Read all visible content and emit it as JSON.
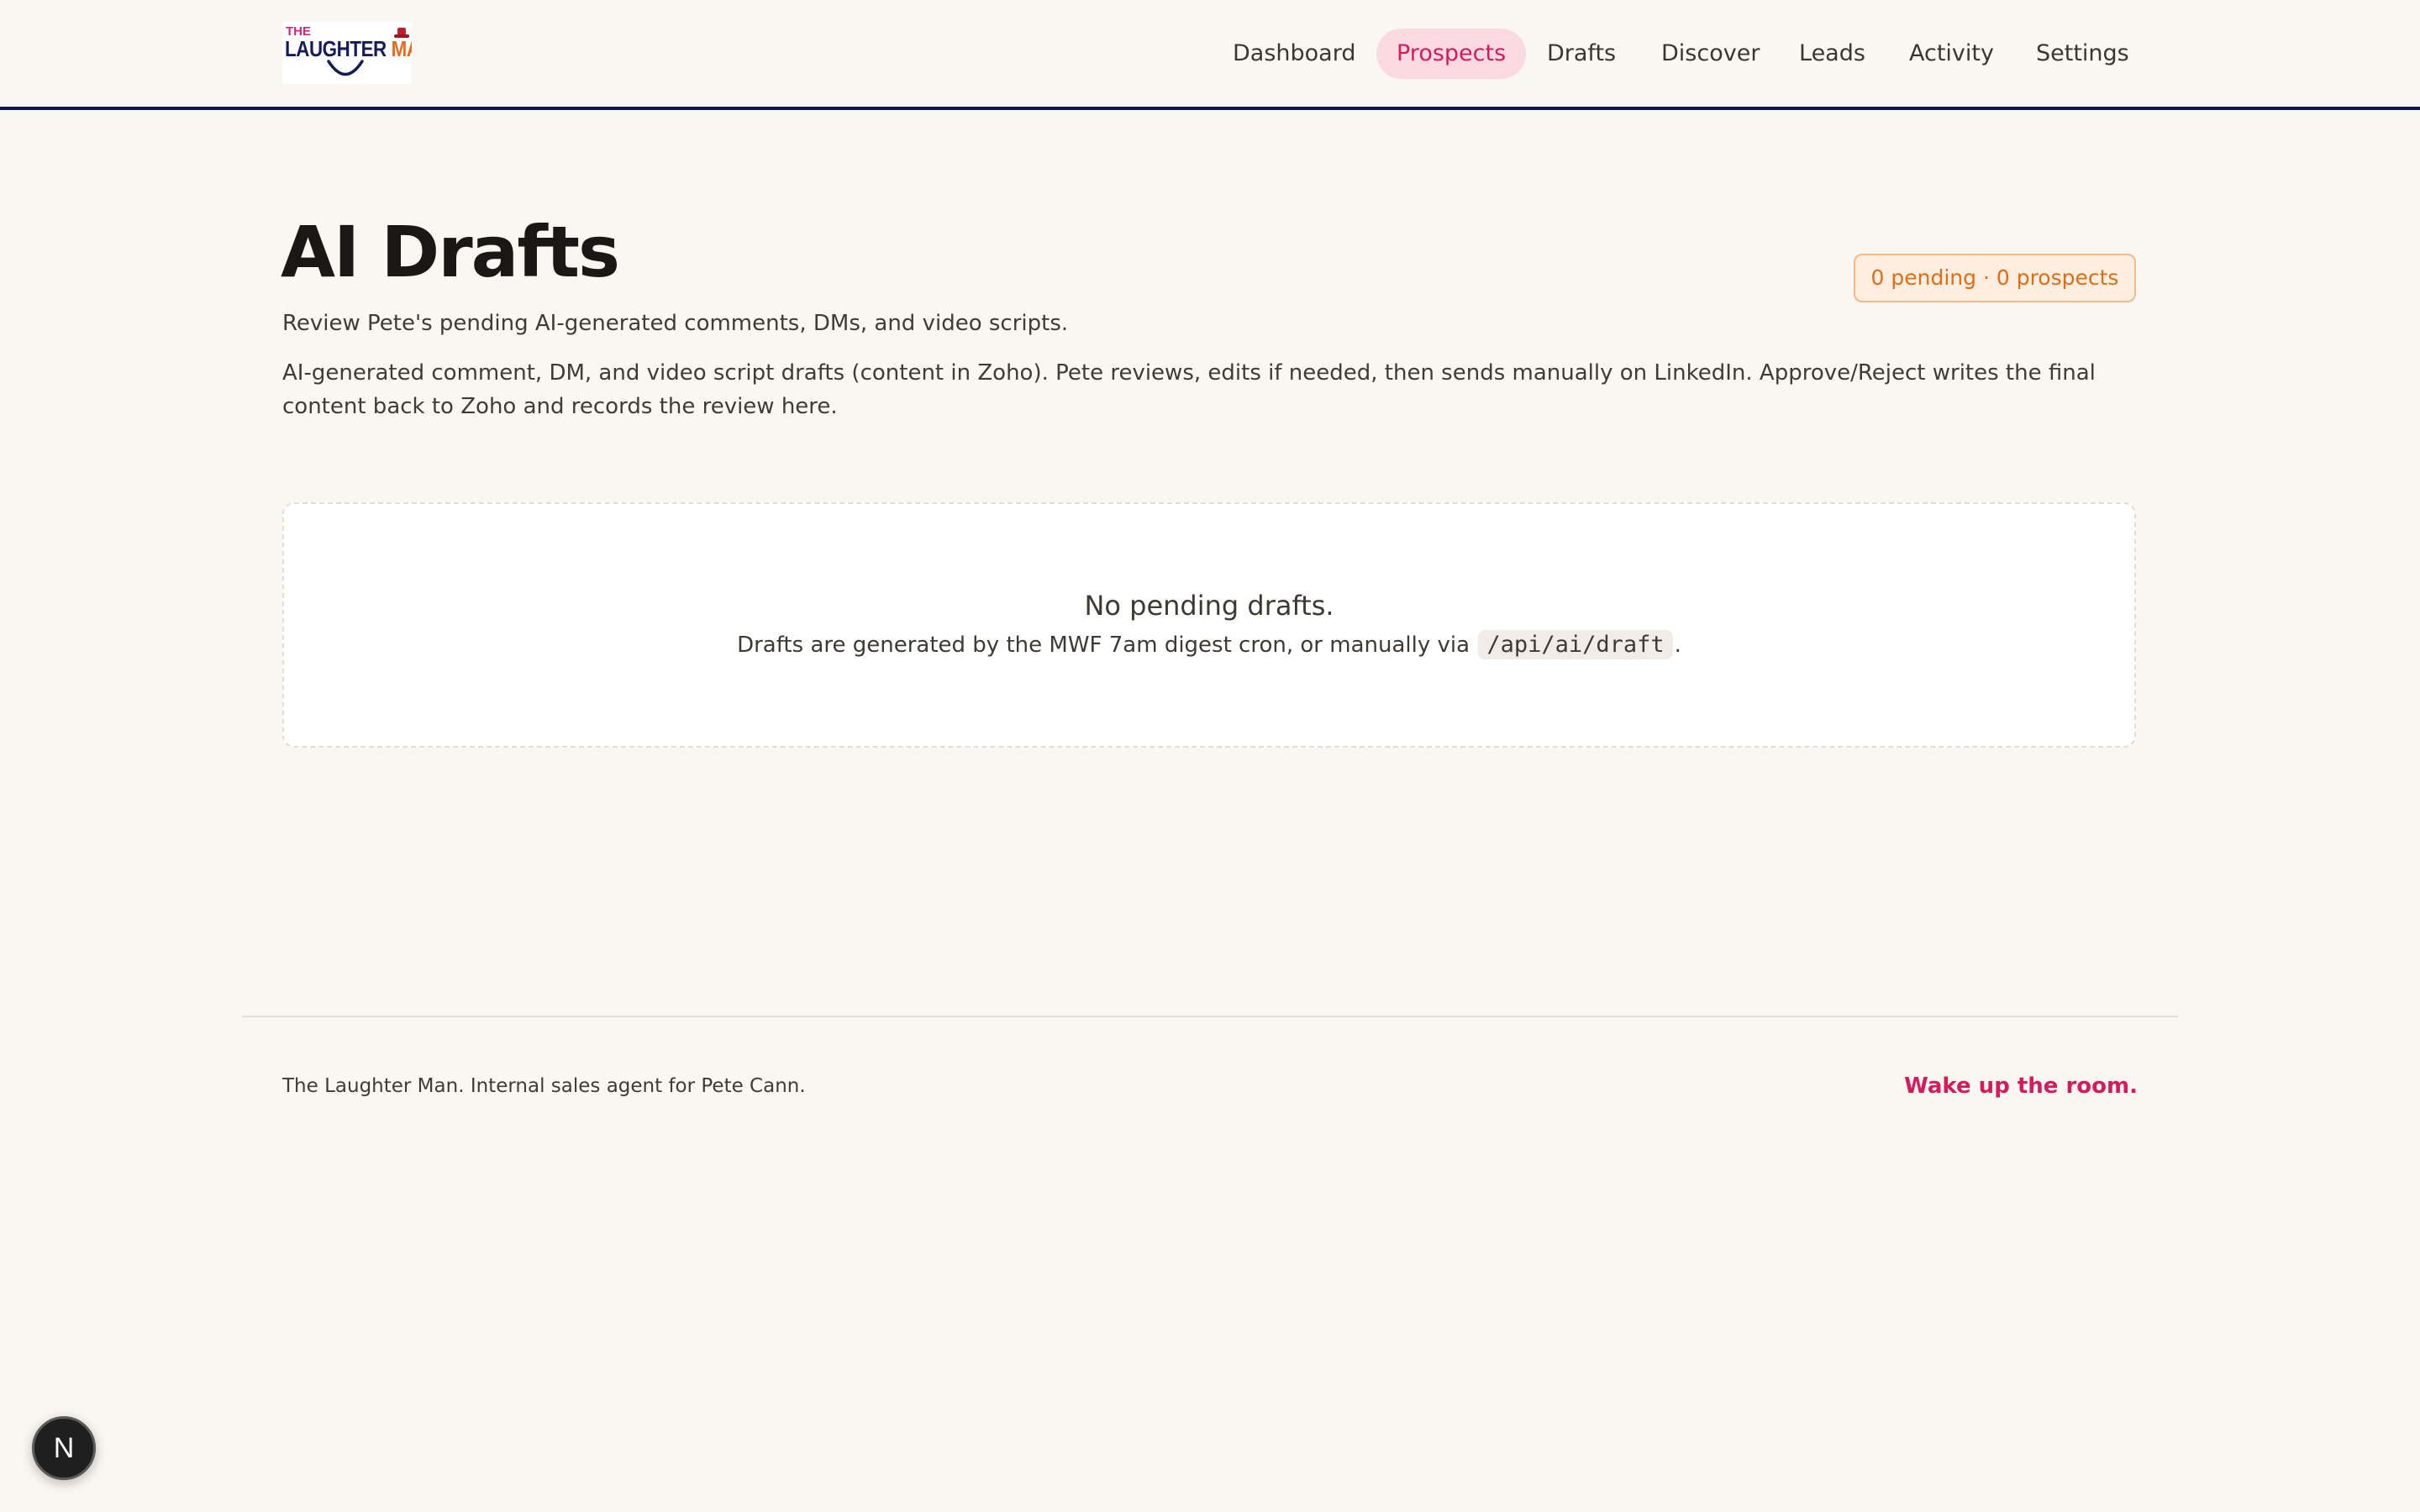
{
  "brand": {
    "logo_small": "THE",
    "logo_word1": "LAUGHTER",
    "logo_word2": "MAN"
  },
  "nav": {
    "items": [
      {
        "label": "Dashboard",
        "active": false
      },
      {
        "label": "Prospects",
        "active": true
      },
      {
        "label": "Drafts",
        "active": false
      },
      {
        "label": "Discover",
        "active": false
      },
      {
        "label": "Leads",
        "active": false
      },
      {
        "label": "Activity",
        "active": false
      },
      {
        "label": "Settings",
        "active": false
      }
    ]
  },
  "page": {
    "title": "AI Drafts",
    "badge": "0 pending · 0 prospects",
    "subtitle": "Review Pete's pending AI-generated comments, DMs, and video scripts.",
    "description": "AI-generated comment, DM, and video script drafts (content in Zoho). Pete reviews, edits if needed, then sends manually on LinkedIn. Approve/Reject writes the final content back to Zoho and records the review here."
  },
  "empty_state": {
    "title": "No pending drafts.",
    "hint_prefix": "Drafts are generated by the MWF 7am digest cron, or manually via",
    "hint_code": "/api/ai/draft",
    "hint_suffix": "."
  },
  "footer": {
    "left": "The Laughter Man. Internal sales agent for Pete Cann.",
    "right": "Wake up the room."
  },
  "dev_badge": {
    "label": "N"
  },
  "colors": {
    "background": "#faf7f2",
    "header_rule": "#12174a",
    "accent_pink": "#d41c5c",
    "active_nav_bg": "#fbd9e2",
    "badge_orange": "#e06d17"
  }
}
